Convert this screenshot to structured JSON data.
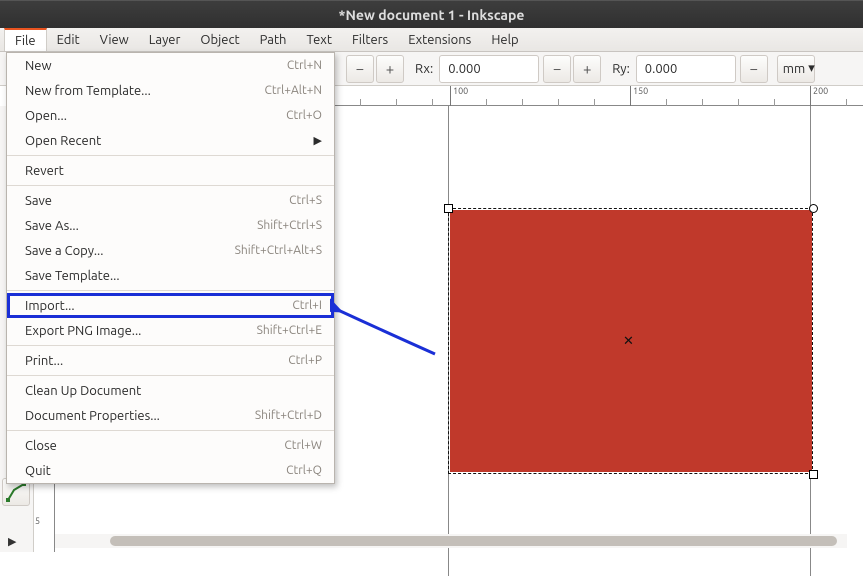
{
  "window": {
    "title": "*New document 1 - Inkscape"
  },
  "menubar": [
    "File",
    "Edit",
    "View",
    "Layer",
    "Object",
    "Path",
    "Text",
    "Filters",
    "Extensions",
    "Help"
  ],
  "menubar_active": 0,
  "toolbar": {
    "rx_label": "Rx:",
    "rx_value": "0.000",
    "ry_label": "Ry:",
    "ry_value": "0.000",
    "unit": "mm"
  },
  "ruler": {
    "horizontal": [
      {
        "pos": 100.0,
        "label": "100"
      },
      {
        "pos": 150.0,
        "label": "150"
      },
      {
        "pos": 200.0,
        "label": "200"
      }
    ]
  },
  "file_menu": [
    {
      "label": "New",
      "accel": "Ctrl+N"
    },
    {
      "label": "New from Template...",
      "accel": "Ctrl+Alt+N"
    },
    {
      "label": "Open...",
      "accel": "Ctrl+O"
    },
    {
      "label": "Open Recent",
      "submenu": true
    },
    {
      "sep": true
    },
    {
      "label": "Revert"
    },
    {
      "sep": true
    },
    {
      "label": "Save",
      "accel": "Ctrl+S"
    },
    {
      "label": "Save As...",
      "accel": "Shift+Ctrl+S"
    },
    {
      "label": "Save a Copy...",
      "accel": "Shift+Ctrl+Alt+S"
    },
    {
      "label": "Save Template..."
    },
    {
      "sep": true
    },
    {
      "label": "Import...",
      "accel": "Ctrl+I",
      "highlight": true
    },
    {
      "label": "Export PNG Image...",
      "accel": "Shift+Ctrl+E"
    },
    {
      "sep": true
    },
    {
      "label": "Print...",
      "accel": "Ctrl+P"
    },
    {
      "sep": true
    },
    {
      "label": "Clean Up Document"
    },
    {
      "label": "Document Properties...",
      "accel": "Shift+Ctrl+D"
    },
    {
      "sep": true
    },
    {
      "label": "Close",
      "accel": "Ctrl+W"
    },
    {
      "label": "Quit",
      "accel": "Ctrl+Q"
    }
  ],
  "canvas": {
    "rect_color": "#c0392b"
  }
}
